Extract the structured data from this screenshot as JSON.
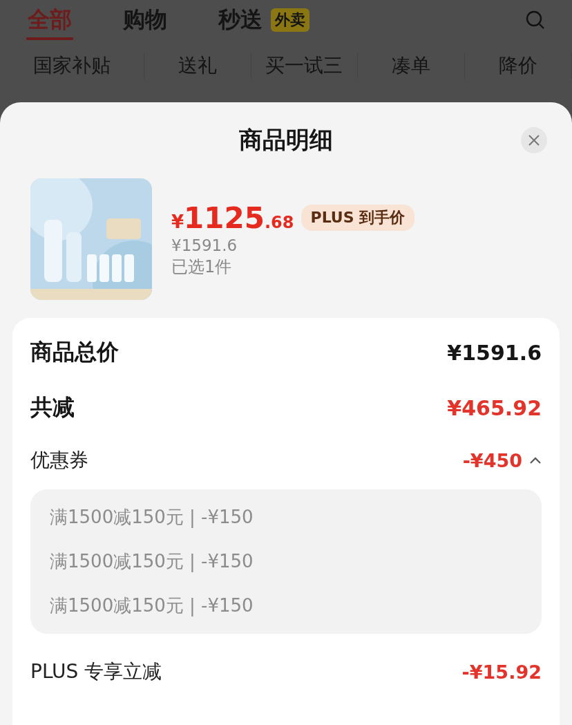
{
  "top_tabs": [
    {
      "label": "全部",
      "selected": true
    },
    {
      "label": "购物",
      "selected": false
    },
    {
      "label": "秒送",
      "selected": false,
      "badge": "外卖"
    }
  ],
  "sub_nav": [
    "国家补贴",
    "送礼",
    "买一试三",
    "凑单",
    "降价"
  ],
  "sheet": {
    "title": "商品明细",
    "product": {
      "price": {
        "symbol": "¥",
        "integer": "1125",
        "decimal": ".68"
      },
      "price_tag": "PLUS 到手价",
      "original_price": "¥1591.6",
      "quantity": "已选1件"
    },
    "summary": [
      {
        "label": "商品总价",
        "value": "¥1591.6",
        "kind": "total"
      },
      {
        "label": "共减",
        "value": "¥465.92",
        "kind": "discount"
      }
    ],
    "coupon": {
      "label": "优惠券",
      "value": "-¥450",
      "expanded": true,
      "items": [
        "满1500减150元 | -¥150",
        "满1500减150元 | -¥150",
        "满1500减150元 | -¥150"
      ]
    },
    "plus": {
      "label": "PLUS 专享立减",
      "value": "-¥15.92"
    }
  }
}
